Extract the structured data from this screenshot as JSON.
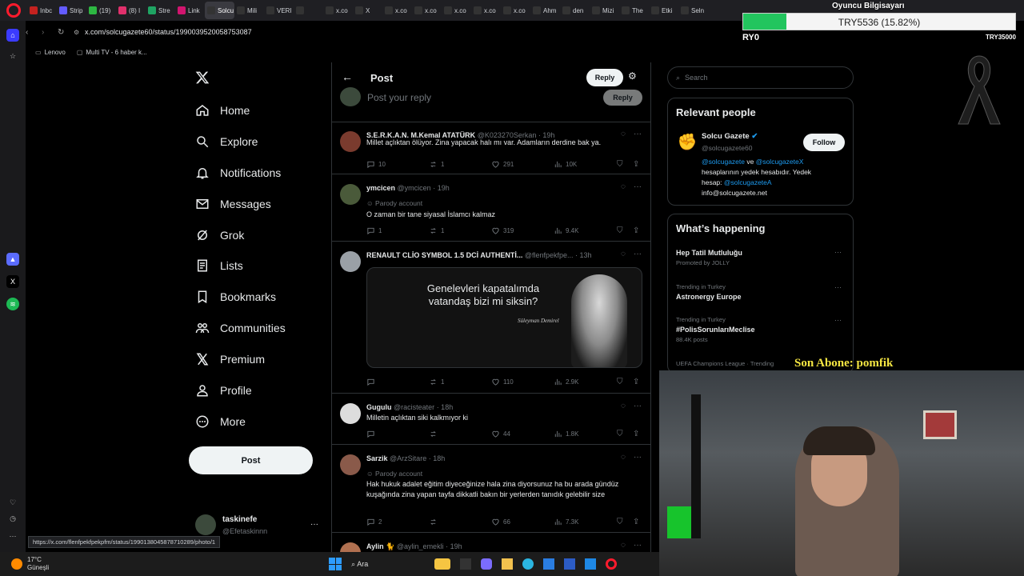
{
  "browser": {
    "tabs": [
      {
        "label": "Inbc",
        "color": "#c5221f"
      },
      {
        "label": "Strip",
        "color": "#635bff"
      },
      {
        "label": "(19)",
        "color": "#2db742"
      },
      {
        "label": "(8) I",
        "color": "#e1306c"
      },
      {
        "label": "Stre",
        "color": "#1fa463"
      },
      {
        "label": "Link",
        "color": "#d1156f",
        "active": false
      },
      {
        "label": "Solcu G",
        "color": "#333",
        "active": true
      },
      {
        "label": "Mili",
        "color": "#333"
      },
      {
        "label": "VERI",
        "color": "#333"
      },
      {
        "label": "",
        "color": "#333"
      },
      {
        "label": "x.co",
        "color": "#333"
      },
      {
        "label": "X",
        "color": "#333"
      },
      {
        "label": "x.co",
        "color": "#333"
      },
      {
        "label": "x.co",
        "color": "#333"
      },
      {
        "label": "x.co",
        "color": "#333"
      },
      {
        "label": "x.co",
        "color": "#333"
      },
      {
        "label": "x.co",
        "color": "#333"
      },
      {
        "label": "Ahm",
        "color": "#333"
      },
      {
        "label": "den",
        "color": "#333"
      },
      {
        "label": "Mizi",
        "color": "#333"
      },
      {
        "label": "The",
        "color": "#333"
      },
      {
        "label": "Etki",
        "color": "#333"
      },
      {
        "label": "Seln",
        "color": "#333"
      }
    ],
    "url": "x.com/solcugazete60/status/1990039520058753087",
    "bookmarks": [
      "Lenovo",
      "Multi TV - 6 haber k..."
    ],
    "status_url": "https://x.com/flenfpekfpekpfm/status/1990138045878710289/photo/1"
  },
  "overlay": {
    "streamer_label": "Oyuncu Bilgisayarı",
    "donation_text": "TRY5536 (15.82%)",
    "progress_fraction": 0.1582,
    "left_text": "RY0",
    "right_text": "TRY35000",
    "subscriber": "Son Abone: pomfik"
  },
  "nav": {
    "items": [
      {
        "label": "Home",
        "icon": "home-icon"
      },
      {
        "label": "Explore",
        "icon": "search-icon"
      },
      {
        "label": "Notifications",
        "icon": "bell-icon"
      },
      {
        "label": "Messages",
        "icon": "mail-icon"
      },
      {
        "label": "Grok",
        "icon": "grok-icon"
      },
      {
        "label": "Lists",
        "icon": "list-icon"
      },
      {
        "label": "Bookmarks",
        "icon": "bookmark-icon"
      },
      {
        "label": "Communities",
        "icon": "people-icon"
      },
      {
        "label": "Premium",
        "icon": "x-icon"
      },
      {
        "label": "Profile",
        "icon": "person-icon"
      },
      {
        "label": "More",
        "icon": "more-circle-icon"
      }
    ],
    "post_label": "Post",
    "account_name": "taskinefe",
    "account_handle": "@Efetaskinnn"
  },
  "main": {
    "header_title": "Post",
    "reply_button": "Reply",
    "composer_placeholder": "Post your reply",
    "composer_reply": "Reply",
    "tweets": [
      {
        "name": "S.E.R.K.A.N. M.Kemal ATATÜRK",
        "handle": "@K023270Serkan",
        "time": "· 19h",
        "text": "Millet açlıktan ölüyor. Zina yapacak halı mı var. Adamların derdine bak ya.",
        "parody": "",
        "replies": "10",
        "reposts": "1",
        "likes": "291",
        "views": "10K",
        "avatar": "#7a3b2e"
      },
      {
        "name": "ymcicen",
        "handle": "@ymcicen",
        "time": "· 19h",
        "text": "O zaman bir tane siyasal İslamcı kalmaz",
        "parody": "Parody account",
        "replies": "1",
        "reposts": "1",
        "likes": "319",
        "views": "9.4K",
        "avatar": "#4a5a3a"
      },
      {
        "name": "RENAULT CLİO SYMBOL 1.5 DCİ AUTHENTİ...",
        "handle": "@flenfpekfpe...",
        "time": "· 13h",
        "text": "",
        "parody": "",
        "replies": "",
        "reposts": "1",
        "likes": "110",
        "views": "2.9K",
        "avatar": "#9aa0a6",
        "image": {
          "line1": "Genelevleri kapatalımda",
          "line2": "vatandaş bizi mi siksin?",
          "signature": "Süleyman Demirel"
        }
      },
      {
        "name": "Gugulu",
        "handle": "@racisteater",
        "time": "· 18h",
        "text": "Milletin açlıktan siki kalkmıyor ki",
        "parody": "",
        "replies": "",
        "reposts": "",
        "likes": "44",
        "views": "1.8K",
        "avatar": "#dddddd"
      },
      {
        "name": "Sarzik",
        "handle": "@ArzSitare",
        "time": "· 18h",
        "text": "Hak hukuk adalet eğitim diyeceğinize hala zina diyorsunuz ha bu arada gündüz kuşağında zina yapan tayfa dikkatli bakın bir yerlerden tanıdık gelebilir size",
        "parody": "Parody account",
        "replies": "2",
        "reposts": "",
        "likes": "66",
        "views": "7.3K",
        "avatar": "#8a5a4a"
      },
      {
        "name": "Aylin 🐈",
        "handle": "@aylin_emekli",
        "time": "· 19h",
        "text": "",
        "parody": "",
        "replies": "",
        "reposts": "",
        "likes": "",
        "views": "",
        "avatar": "#b07050"
      }
    ]
  },
  "right": {
    "search_placeholder": "Search",
    "relevant_title": "Relevant people",
    "person_name": "Solcu Gazete",
    "person_handle": "@solcugazete60",
    "follow_label": "Follow",
    "bio_link1": "@solcugazete",
    "bio_mid": " ve ",
    "bio_link2": "@solcugazeteX",
    "bio_line2": "hesaplarının yedek hesabıdır. Yedek",
    "bio_line3_prefix": "hesap: ",
    "bio_link3": "@solcugazeteA",
    "bio_email": "info@solcugazete.net",
    "happening_title": "What’s happening",
    "trends": [
      {
        "title": "Hep Tatil Mutluluğu",
        "sub": "Promoted by JOLLY"
      },
      {
        "sub": "Trending in Turkey",
        "title": "Astronergy Europe"
      },
      {
        "sub": "Trending in Turkey",
        "title": "#PolisSorunlarıMeclise",
        "count": "88.4K posts"
      },
      {
        "sub": "UEFA Champions League · Trending",
        "title": ""
      }
    ]
  },
  "taskbar": {
    "temp": "17°C",
    "place": "Güneşli",
    "search": "Ara"
  },
  "colors": {
    "accent": "#1d9bf0",
    "bg": "#000000",
    "border": "#2f3336",
    "muted": "#71767b",
    "progress": "#22c55e",
    "overlay_gold": "#f5e642"
  }
}
